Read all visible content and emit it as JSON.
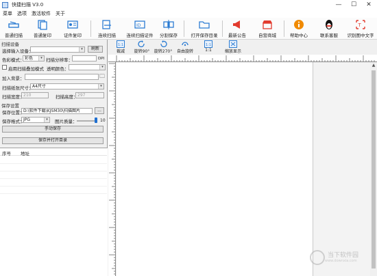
{
  "window": {
    "title": "快捷扫描 V3.0",
    "minimize": "—",
    "maximize": "☐",
    "close": "✕"
  },
  "menu": [
    "菜单",
    "选项",
    "激活软件",
    "关于"
  ],
  "toolbar": [
    {
      "label": "普通扫描",
      "icon": "scanner-icon"
    },
    {
      "label": "普通复印",
      "icon": "copier-icon"
    },
    {
      "label": "证件复印",
      "icon": "id-card-copy-icon"
    },
    {
      "label": "连续扫描",
      "icon": "continuous-scan-icon"
    },
    {
      "label": "连续扫描证件",
      "icon": "continuous-id-scan-icon"
    },
    {
      "label": "分割保存",
      "icon": "split-save-icon"
    },
    {
      "label": "打开保存目录",
      "icon": "folder-icon"
    },
    {
      "label": "最新公告",
      "icon": "megaphone-icon"
    },
    {
      "label": "自营商城",
      "icon": "shop-icon"
    },
    {
      "label": "帮助中心",
      "icon": "info-icon"
    },
    {
      "label": "联系客服",
      "icon": "qq-penguin-icon"
    },
    {
      "label": "识别图中文字",
      "icon": "ocr-icon"
    }
  ],
  "view_tools": [
    {
      "label": "裁减",
      "icon": "crop-icon",
      "badge": "1:1"
    },
    {
      "label": "旋转90°",
      "icon": "rotate-cw-icon"
    },
    {
      "label": "旋转270°",
      "icon": "rotate-ccw-icon"
    },
    {
      "label": "自由旋转",
      "icon": "free-rotate-icon"
    },
    {
      "label": "1:1",
      "icon": "actual-size-icon",
      "badge": "1:1"
    },
    {
      "label": "缩放显示",
      "icon": "fit-zoom-icon"
    }
  ],
  "scan_settings": {
    "group_title": "扫描设备",
    "input_device_label": "选择输入设备：",
    "input_device_value": "",
    "refresh_button": "刷新",
    "color_mode_label": "色彩模式：",
    "color_mode_value": "彩色",
    "resolution_label": "扫描分辨率：",
    "resolution_value": "",
    "resolution_unit": "DPI",
    "overlay_label": "启用扫描叠加模式",
    "transparency_label": "透明颜色：",
    "transparency_value": "",
    "background_label": "加入背景：",
    "background_value": "",
    "paper_size_label": "扫描纸张尺寸：",
    "paper_size_value": "A4尺寸",
    "width_label": "扫描宽度：",
    "width_value": "210",
    "height_label": "扫描高度：",
    "height_value": "297"
  },
  "save_settings": {
    "group_title": "保存设置",
    "location_label": "保存位置：",
    "location_value": "D:\\软件下载\\KJSM30\\扫描图片",
    "browse_button": "...",
    "format_label": "保存格式：",
    "format_value": "JPG",
    "quality_label": "图片质量：",
    "quality_value": "10",
    "quality_level": 1.0,
    "manual_save_button": "手动保存",
    "save_open_button": "保存并打开目录"
  },
  "file_list": {
    "columns": [
      "序号",
      "地址"
    ],
    "rows": []
  },
  "watermark": {
    "text": "当下软件园",
    "sub": "www.downxia.com"
  },
  "colors": {
    "accent": "#1f6fd0",
    "canvas": "#ffffff",
    "toolbar_blue": "#2b7cd3",
    "megaphone": "#e23b2e",
    "info": "#f08a00"
  }
}
